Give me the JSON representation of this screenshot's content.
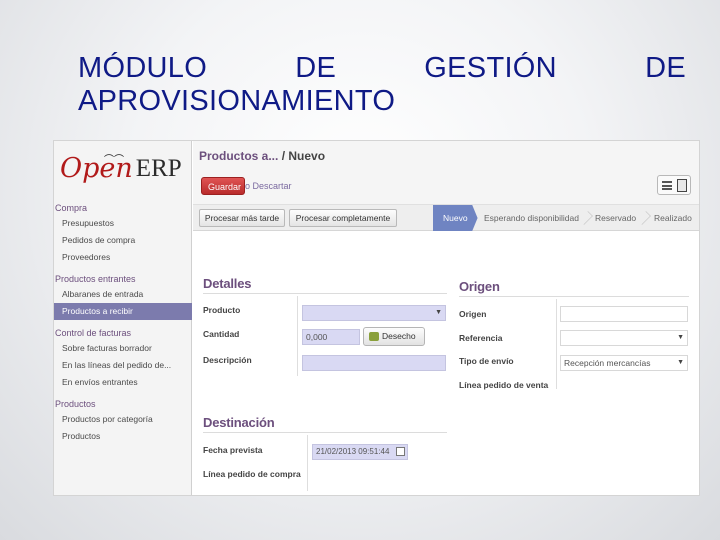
{
  "slide": {
    "title_words": [
      "MÓDULO",
      "DE",
      "GESTIÓN",
      "DE"
    ],
    "title_line2": "APROVISIONAMIENTO"
  },
  "app": {
    "logo_open": "Open",
    "logo_erp": "ERP",
    "breadcrumb_parent": "Productos a...",
    "breadcrumb_sep": "/",
    "breadcrumb_current": "Nuevo",
    "save_label": "Guardar",
    "discard_label": "o Descartar"
  },
  "sidebar": {
    "sections": [
      {
        "title": "Compra",
        "items": [
          "Presupuestos",
          "Pedidos de compra",
          "Proveedores"
        ]
      },
      {
        "title": "Productos entrantes",
        "items": [
          "Albaranes de entrada",
          "Productos a recibir"
        ]
      },
      {
        "title": "Control de facturas",
        "items": [
          "Sobre facturas borrador",
          "En las líneas del pedido de...",
          "En envíos entrantes"
        ]
      },
      {
        "title": "Productos",
        "items": [
          "Productos por categoría",
          "Productos"
        ]
      }
    ],
    "active_item": "Productos a recibir"
  },
  "statusbar": {
    "buttons": [
      "Procesar más tarde",
      "Procesar completamente"
    ],
    "stages": [
      "Nuevo",
      "Esperando disponibilidad",
      "Reservado",
      "Realizado"
    ],
    "current_stage": "Nuevo"
  },
  "form": {
    "detalles": {
      "title": "Detalles",
      "producto_label": "Producto",
      "cantidad_label": "Cantidad",
      "cantidad_value": "0,000",
      "desecho_label": "Desecho",
      "descripcion_label": "Descripción"
    },
    "origen": {
      "title": "Origen",
      "origen_label": "Origen",
      "referencia_label": "Referencia",
      "tipo_envio_label": "Tipo de envío",
      "tipo_envio_value": "Recepción mercancías",
      "linea_pedido_label": "Línea pedido de venta"
    },
    "destinacion": {
      "title": "Destinación",
      "fecha_label": "Fecha prevista",
      "fecha_value": "21/02/2013 09:51:44",
      "linea_compra_label": "Línea pedido de compra"
    }
  },
  "colors": {
    "title_blue": "#0f1a86",
    "accent_purple": "#6c4f7d",
    "active_item": "#7c7bad",
    "save_red": "#c83636",
    "current_stage": "#6f84c2",
    "required_field": "#d9d9f3"
  }
}
